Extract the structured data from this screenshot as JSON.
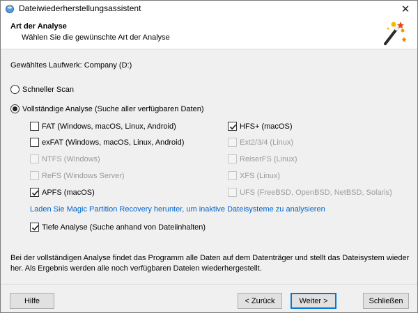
{
  "window": {
    "title": "Dateiwiederherstellungsassistent",
    "close_symbol": "✕"
  },
  "header": {
    "title": "Art der Analyse",
    "subtitle": "Wählen Sie die gewünschte Art der Analyse",
    "icon": "magic-wand-icon"
  },
  "drive_label": "Gewähltes Laufwerk: Company (D:)",
  "scan_options": {
    "quick": {
      "label": "Schneller Scan",
      "selected": false
    },
    "full": {
      "label": "Vollständige Analyse (Suche aller verfügbaren Daten)",
      "selected": true
    }
  },
  "filesystems": {
    "left": [
      {
        "label": "FAT (Windows, macOS, Linux, Android)",
        "checked": false,
        "enabled": true
      },
      {
        "label": "exFAT (Windows, macOS, Linux, Android)",
        "checked": false,
        "enabled": true
      },
      {
        "label": "NTFS (Windows)",
        "checked": false,
        "enabled": false
      },
      {
        "label": "ReFS (Windows Server)",
        "checked": false,
        "enabled": false
      },
      {
        "label": "APFS (macOS)",
        "checked": true,
        "enabled": true
      }
    ],
    "right": [
      {
        "label": "HFS+ (macOS)",
        "checked": true,
        "enabled": true
      },
      {
        "label": "Ext2/3/4 (Linux)",
        "checked": false,
        "enabled": false
      },
      {
        "label": "ReiserFS (Linux)",
        "checked": false,
        "enabled": false
      },
      {
        "label": "XFS (Linux)",
        "checked": false,
        "enabled": false
      },
      {
        "label": "UFS (FreeBSD, OpenBSD, NetBSD, Solaris)",
        "checked": false,
        "enabled": false
      }
    ]
  },
  "link_text": "Laden Sie Magic Partition Recovery herunter, um inaktive Dateisysteme zu analysieren",
  "deep_analysis": {
    "label": "Tiefe Analyse (Suche anhand von Dateiinhalten)",
    "checked": true
  },
  "info_text": "Bei der vollständigen Analyse findet das Programm alle Daten auf dem Datenträger und stellt das Dateisystem wieder her. Als Ergebnis werden alle noch verfügbaren Dateien wiederhergestellt.",
  "buttons": {
    "help": "Hilfe",
    "back": "< Zurück",
    "next": "Weiter >",
    "close": "Schließen"
  },
  "colors": {
    "link": "#0066cc",
    "primary_border": "#0078d7",
    "disabled_text": "#9a9a9a"
  }
}
